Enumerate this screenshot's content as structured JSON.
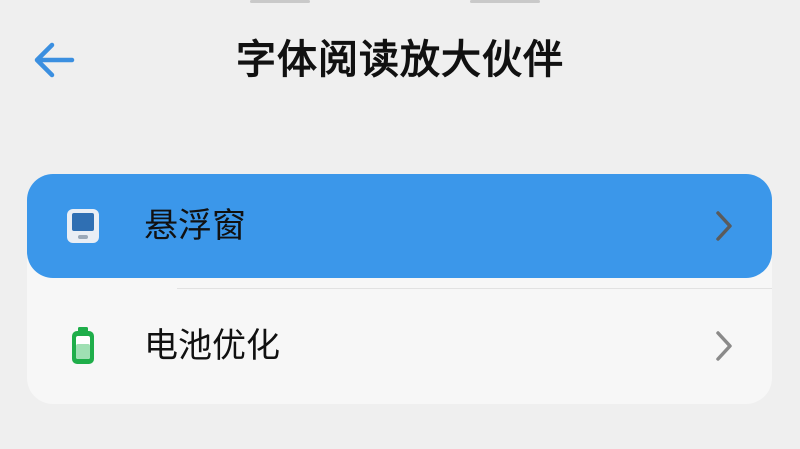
{
  "header": {
    "title": "字体阅读放大伙伴",
    "back_icon": "back-arrow-icon"
  },
  "colors": {
    "background": "#efefef",
    "card": "#f7f7f7",
    "accent": "#3b97ea",
    "back_arrow": "#3b8fe0",
    "battery_green": "#1fae4a"
  },
  "menu": {
    "items": [
      {
        "label": "悬浮窗",
        "icon": "floating-window-icon",
        "selected": true
      },
      {
        "label": "电池优化",
        "icon": "battery-icon",
        "selected": false
      }
    ]
  }
}
